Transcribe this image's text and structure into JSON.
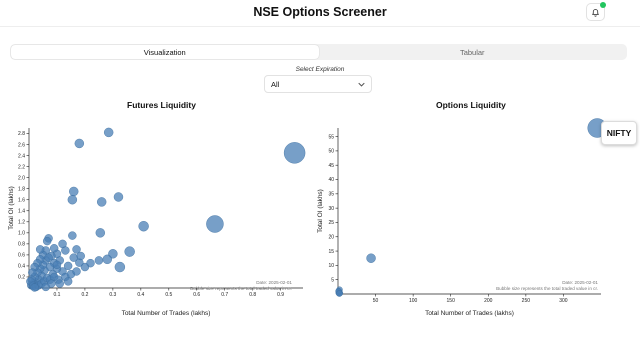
{
  "header": {
    "title": "NSE Options Screener",
    "notification_icon": "bell-icon"
  },
  "tabs": [
    {
      "label": "Visualization",
      "active": true
    },
    {
      "label": "Tabular",
      "active": false
    }
  ],
  "expiration": {
    "label": "Select Expiration",
    "value": "All"
  },
  "colors": {
    "bubble": "#4a7fb5",
    "status_dot": "#22c55e"
  },
  "tooltip": {
    "label": "NIFTY"
  },
  "chart_data": [
    {
      "type": "scatter",
      "title": "Futures Liquidity",
      "xlabel": "Total Number of Trades (lakhs)",
      "ylabel": "Total OI (lakhs)",
      "xlim": [
        0,
        0.98
      ],
      "ylim": [
        0,
        2.9
      ],
      "xticks": [
        "0.1",
        "0.2",
        "0.3",
        "0.4",
        "0.5",
        "0.6",
        "0.7",
        "0.8",
        "0.9"
      ],
      "yticks": [
        "0.2",
        "0.4",
        "0.6",
        "0.8",
        "1.0",
        "1.2",
        "1.4",
        "1.6",
        "1.8",
        "2.0",
        "2.2",
        "2.4",
        "2.6",
        "2.8"
      ],
      "note_date": "Date: 2025-02-01",
      "note_size": "Bubble size represents the total traded value in cr.",
      "points": [
        {
          "x": 0.95,
          "y": 2.45,
          "s": 10.5
        },
        {
          "x": 0.665,
          "y": 1.16,
          "s": 8.5
        },
        {
          "x": 0.285,
          "y": 2.82,
          "s": 4.5
        },
        {
          "x": 0.18,
          "y": 2.62,
          "s": 4.5
        },
        {
          "x": 0.32,
          "y": 1.65,
          "s": 4.5
        },
        {
          "x": 0.16,
          "y": 1.75,
          "s": 4.5
        },
        {
          "x": 0.155,
          "y": 1.6,
          "s": 4.5
        },
        {
          "x": 0.26,
          "y": 1.56,
          "s": 4.5
        },
        {
          "x": 0.41,
          "y": 1.12,
          "s": 5
        },
        {
          "x": 0.255,
          "y": 1.0,
          "s": 4.5
        },
        {
          "x": 0.36,
          "y": 0.66,
          "s": 5
        },
        {
          "x": 0.3,
          "y": 0.62,
          "s": 4.5
        },
        {
          "x": 0.28,
          "y": 0.52,
          "s": 4.5
        },
        {
          "x": 0.325,
          "y": 0.38,
          "s": 5
        },
        {
          "x": 0.25,
          "y": 0.5,
          "s": 4
        },
        {
          "x": 0.22,
          "y": 0.45,
          "s": 4
        },
        {
          "x": 0.2,
          "y": 0.38,
          "s": 4
        },
        {
          "x": 0.18,
          "y": 0.46,
          "s": 4
        },
        {
          "x": 0.17,
          "y": 0.7,
          "s": 4
        },
        {
          "x": 0.16,
          "y": 0.55,
          "s": 4
        },
        {
          "x": 0.155,
          "y": 0.95,
          "s": 4
        },
        {
          "x": 0.14,
          "y": 0.4,
          "s": 4
        },
        {
          "x": 0.13,
          "y": 0.68,
          "s": 4
        },
        {
          "x": 0.12,
          "y": 0.8,
          "s": 4
        },
        {
          "x": 0.12,
          "y": 0.3,
          "s": 4
        },
        {
          "x": 0.11,
          "y": 0.5,
          "s": 4
        },
        {
          "x": 0.1,
          "y": 0.62,
          "s": 4
        },
        {
          "x": 0.1,
          "y": 0.35,
          "s": 4
        },
        {
          "x": 0.09,
          "y": 0.72,
          "s": 4
        },
        {
          "x": 0.09,
          "y": 0.45,
          "s": 4
        },
        {
          "x": 0.085,
          "y": 0.25,
          "s": 4
        },
        {
          "x": 0.08,
          "y": 0.58,
          "s": 4
        },
        {
          "x": 0.075,
          "y": 0.38,
          "s": 4
        },
        {
          "x": 0.07,
          "y": 0.9,
          "s": 4
        },
        {
          "x": 0.065,
          "y": 0.85,
          "s": 4
        },
        {
          "x": 0.06,
          "y": 0.68,
          "s": 4
        },
        {
          "x": 0.06,
          "y": 0.5,
          "s": 4
        },
        {
          "x": 0.055,
          "y": 0.32,
          "s": 4
        },
        {
          "x": 0.05,
          "y": 0.6,
          "s": 4
        },
        {
          "x": 0.05,
          "y": 0.42,
          "s": 4
        },
        {
          "x": 0.045,
          "y": 0.22,
          "s": 4
        },
        {
          "x": 0.04,
          "y": 0.52,
          "s": 4
        },
        {
          "x": 0.04,
          "y": 0.35,
          "s": 4
        },
        {
          "x": 0.035,
          "y": 0.15,
          "s": 4
        },
        {
          "x": 0.03,
          "y": 0.45,
          "s": 4
        },
        {
          "x": 0.03,
          "y": 0.28,
          "s": 4
        },
        {
          "x": 0.025,
          "y": 0.1,
          "s": 4
        },
        {
          "x": 0.02,
          "y": 0.38,
          "s": 4
        },
        {
          "x": 0.02,
          "y": 0.2,
          "s": 4
        },
        {
          "x": 0.015,
          "y": 0.08,
          "s": 4
        },
        {
          "x": 0.012,
          "y": 0.28,
          "s": 4
        },
        {
          "x": 0.01,
          "y": 0.15,
          "s": 4
        },
        {
          "x": 0.008,
          "y": 0.05,
          "s": 4
        },
        {
          "x": 0.005,
          "y": 0.12,
          "s": 4
        },
        {
          "x": 0.015,
          "y": 0.04,
          "s": 4
        },
        {
          "x": 0.025,
          "y": 0.02,
          "s": 4
        },
        {
          "x": 0.035,
          "y": 0.05,
          "s": 4
        },
        {
          "x": 0.045,
          "y": 0.08,
          "s": 4
        },
        {
          "x": 0.055,
          "y": 0.12,
          "s": 4
        },
        {
          "x": 0.065,
          "y": 0.18,
          "s": 4
        },
        {
          "x": 0.075,
          "y": 0.15,
          "s": 4
        },
        {
          "x": 0.09,
          "y": 0.2,
          "s": 4
        },
        {
          "x": 0.105,
          "y": 0.15,
          "s": 4
        },
        {
          "x": 0.13,
          "y": 0.2,
          "s": 4
        },
        {
          "x": 0.15,
          "y": 0.25,
          "s": 4
        },
        {
          "x": 0.17,
          "y": 0.3,
          "s": 4
        },
        {
          "x": 0.06,
          "y": 0.02,
          "s": 4
        },
        {
          "x": 0.08,
          "y": 0.08,
          "s": 4
        },
        {
          "x": 0.02,
          "y": 0.01,
          "s": 4
        },
        {
          "x": 0.11,
          "y": 0.08,
          "s": 4
        },
        {
          "x": 0.14,
          "y": 0.12,
          "s": 4
        },
        {
          "x": 0.04,
          "y": 0.7,
          "s": 4
        },
        {
          "x": 0.07,
          "y": 0.55,
          "s": 4
        },
        {
          "x": 0.1,
          "y": 0.42,
          "s": 4
        },
        {
          "x": 0.185,
          "y": 0.58,
          "s": 4
        }
      ]
    },
    {
      "type": "scatter",
      "title": "Options Liquidity",
      "xlabel": "Total Number of Trades (lakhs)",
      "ylabel": "Total OI (lakhs)",
      "xlim": [
        0,
        350
      ],
      "ylim": [
        0,
        58
      ],
      "xticks": [
        "50",
        "100",
        "150",
        "200",
        "250",
        "300"
      ],
      "yticks": [
        "5",
        "10",
        "15",
        "20",
        "25",
        "30",
        "35",
        "40",
        "45",
        "50",
        "55"
      ],
      "note_date": "Date: 2025-02-01",
      "note_size": "Bubble size represents the total traded value in cr.",
      "points": [
        {
          "x": 345,
          "y": 58,
          "s": 9.5
        },
        {
          "x": 44,
          "y": 12.5,
          "s": 4.5
        },
        {
          "x": 2,
          "y": 1.5,
          "s": 3
        },
        {
          "x": 1.5,
          "y": 0.8,
          "s": 3
        },
        {
          "x": 1,
          "y": 0.4,
          "s": 3
        },
        {
          "x": 2.5,
          "y": 0.3,
          "s": 3
        },
        {
          "x": 0.8,
          "y": 1.0,
          "s": 3
        },
        {
          "x": 1.8,
          "y": 0.15,
          "s": 3
        }
      ]
    }
  ]
}
